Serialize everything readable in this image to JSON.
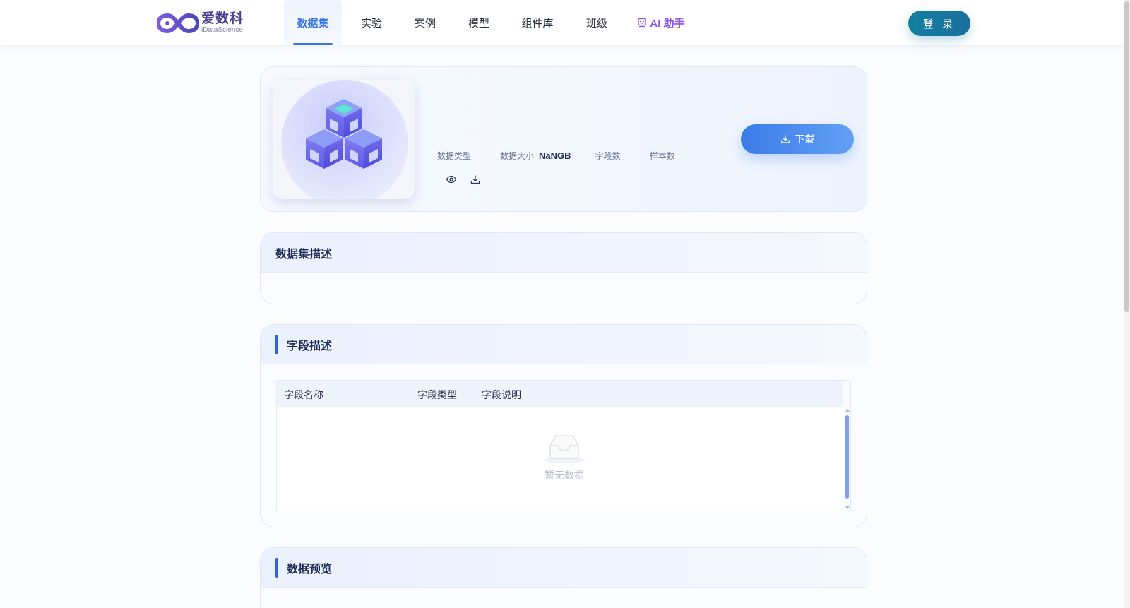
{
  "header": {
    "logo_cn": "爱数科",
    "logo_en": "iDataScience",
    "nav": [
      {
        "label": "数据集"
      },
      {
        "label": "实验"
      },
      {
        "label": "案例"
      },
      {
        "label": "模型"
      },
      {
        "label": "组件库"
      },
      {
        "label": "班级"
      },
      {
        "label": "AI 助手"
      }
    ],
    "active_nav": "数据集",
    "login_label": "登 录"
  },
  "dataset": {
    "meta": {
      "type_label": "数据类型",
      "type_value": "",
      "size_label": "数据大小",
      "size_value": "NaNGB",
      "field_count_label": "字段数",
      "field_count_value": "",
      "sample_count_label": "样本数",
      "sample_count_value": ""
    },
    "download_label": "下载"
  },
  "description_card": {
    "title": "数据集描述",
    "body": ""
  },
  "fields_card": {
    "title": "字段描述",
    "columns": [
      "字段名称",
      "字段类型",
      "字段说明"
    ],
    "rows": [],
    "empty_text": "暂无数据"
  },
  "preview_card": {
    "title": "数据预览"
  },
  "colors": {
    "accent": "#3a75e4",
    "login": "#12809e",
    "ai": "#8a53e6",
    "title": "#1d2b55"
  }
}
